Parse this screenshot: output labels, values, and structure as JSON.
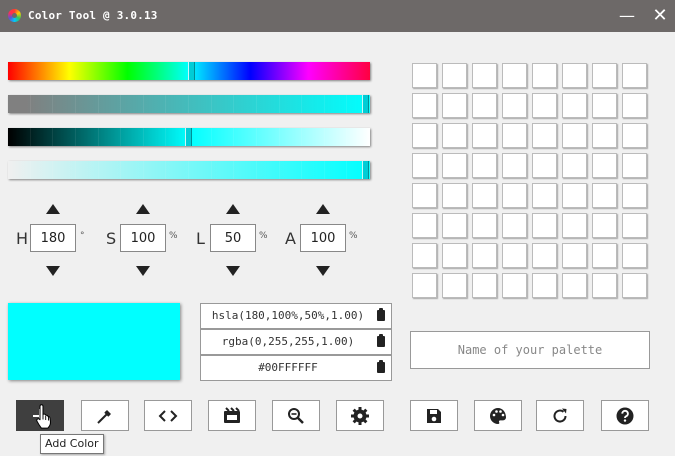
{
  "window": {
    "title": "Color Tool @ 3.0.13",
    "minimize_glyph": "—",
    "close_glyph": "✕"
  },
  "current_color": {
    "hex_value": "#00FFFF",
    "hue": 180,
    "saturation": 100,
    "lightness": 50,
    "alpha": 100
  },
  "controls": {
    "hue": {
      "label": "H",
      "value": "180",
      "unit": "°"
    },
    "saturation": {
      "label": "S",
      "value": "100",
      "unit": "%"
    },
    "lightness": {
      "label": "L",
      "value": "50",
      "unit": "%"
    },
    "alpha": {
      "label": "A",
      "value": "100",
      "unit": "%"
    }
  },
  "formats": {
    "hsla": "hsla(180,100%,50%,1.00)",
    "rgba": "rgba(0,255,255,1.00)",
    "hex": "#00FFFFFF"
  },
  "palette": {
    "name_placeholder": "Name of your palette",
    "name_value": "",
    "rows": 8,
    "cols": 8
  },
  "toolbar": {
    "buttons": [
      "add-color",
      "eyedropper",
      "code",
      "palette-library",
      "zoom",
      "settings",
      "save",
      "palette",
      "refresh",
      "help"
    ]
  },
  "tooltip": {
    "text": "Add Color"
  },
  "colors": {
    "titlebar": "#6d6968",
    "background": "#f0f0f0",
    "accent": "#00ffff",
    "active_button": "#3f3f3f"
  }
}
